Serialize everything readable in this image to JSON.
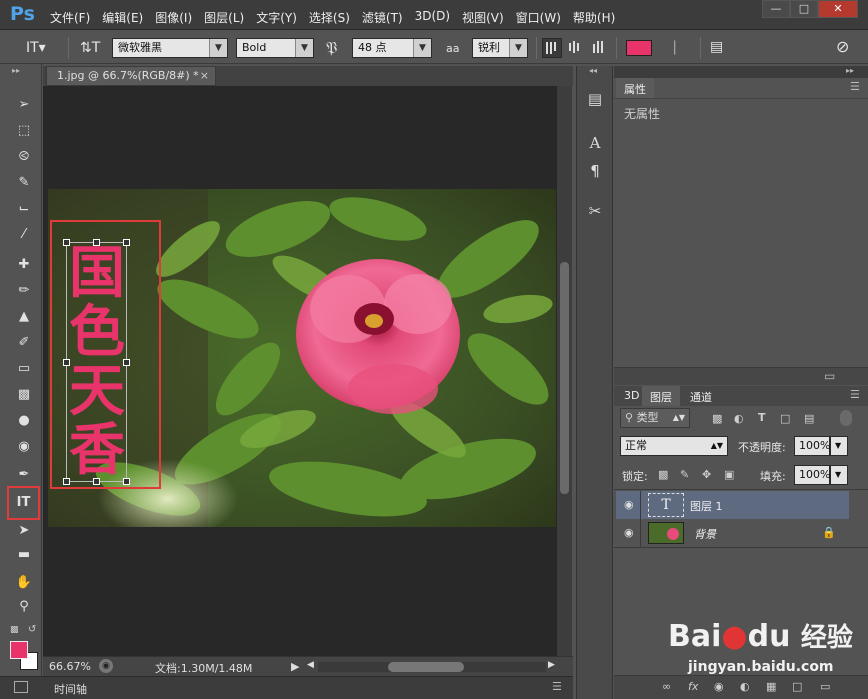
{
  "app": {
    "logo": "Ps"
  },
  "menu": [
    "文件(F)",
    "编辑(E)",
    "图像(I)",
    "图层(L)",
    "文字(Y)",
    "选择(S)",
    "滤镜(T)",
    "3D(D)",
    "视图(V)",
    "窗口(W)",
    "帮助(H)"
  ],
  "options": {
    "font_family": "微软雅黑",
    "font_style": "Bold",
    "font_size": "48 点",
    "antialias_icon": "aa",
    "antialias": "锐利",
    "text_color": "#e8336b"
  },
  "document": {
    "tab_title": "1.jpg @ 66.7%(RGB/8#) *",
    "text_content": [
      "国",
      "色",
      "天",
      "香"
    ],
    "text_color": "#e8336b"
  },
  "status": {
    "zoom": "66.67%",
    "doc_info": "文档:1.30M/1.48M"
  },
  "timeline": {
    "label": "时间轴"
  },
  "properties": {
    "tab": "属性",
    "empty": "无属性"
  },
  "layers_panel": {
    "tabs": [
      "3D",
      "图层",
      "通道"
    ],
    "filter_kind": "类型",
    "blend_mode": "正常",
    "opacity_label": "不透明度:",
    "opacity_value": "100%",
    "lock_label": "锁定:",
    "fill_label": "填充:",
    "fill_value": "100%",
    "layers": [
      {
        "name": "图层 1",
        "thumb": "T",
        "selected": true
      },
      {
        "name": "背景",
        "thumb": "",
        "selected": false
      }
    ]
  },
  "colors": {
    "foreground": "#e8336b",
    "background": "#ffffff"
  },
  "watermark": {
    "brand_a": "Bai",
    "brand_b": "du",
    "cn": "经验",
    "url": "jingyan.baidu.com"
  }
}
